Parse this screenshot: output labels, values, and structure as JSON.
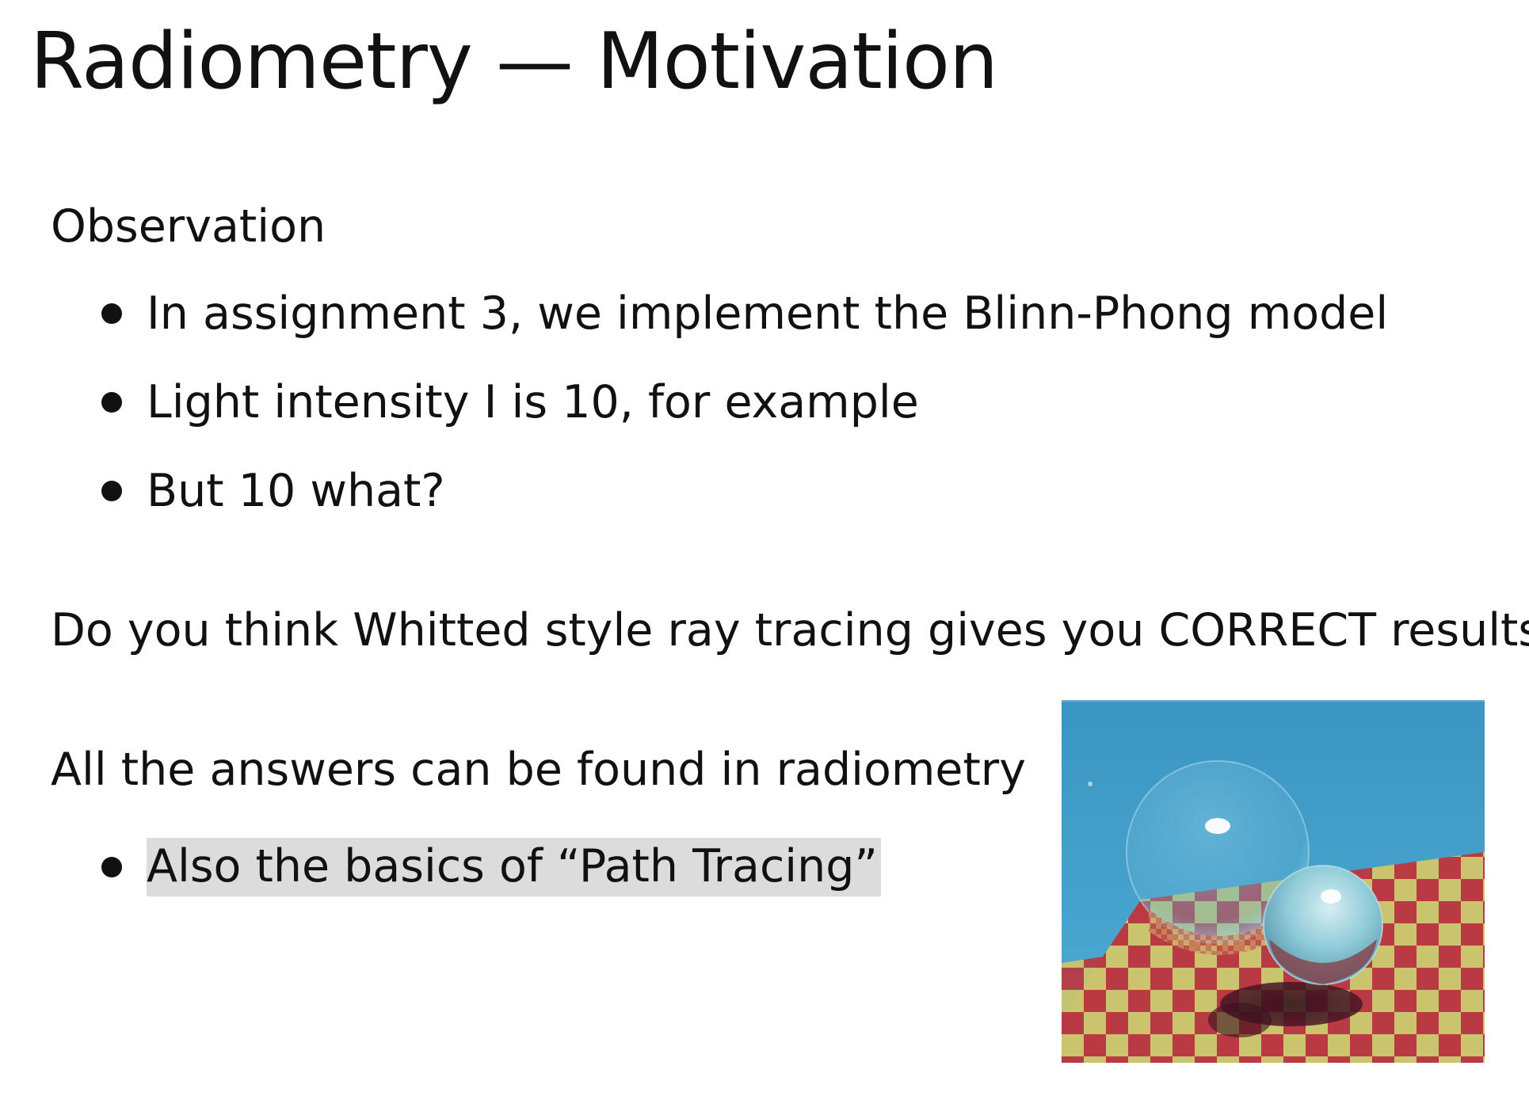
{
  "slide": {
    "title": "Radiometry — Motivation"
  },
  "observation": {
    "heading": "Observation",
    "bullets": [
      "In assignment 3, we implement the Blinn-Phong model",
      "Light intensity I is 10, for example",
      "But 10 what?"
    ]
  },
  "question": {
    "text": "Do you think Whitted style ray tracing gives you CORRECT results?"
  },
  "answers": {
    "heading": "All the answers can be found in radiometry",
    "bullets": [
      "Also the basics of “Path Tracing”"
    ]
  },
  "image": {
    "colors": {
      "sky": "#3f98c4",
      "checker_red": "#b93a43",
      "checker_yellow": "#c9c46d",
      "shadow": "#3a1020"
    }
  }
}
